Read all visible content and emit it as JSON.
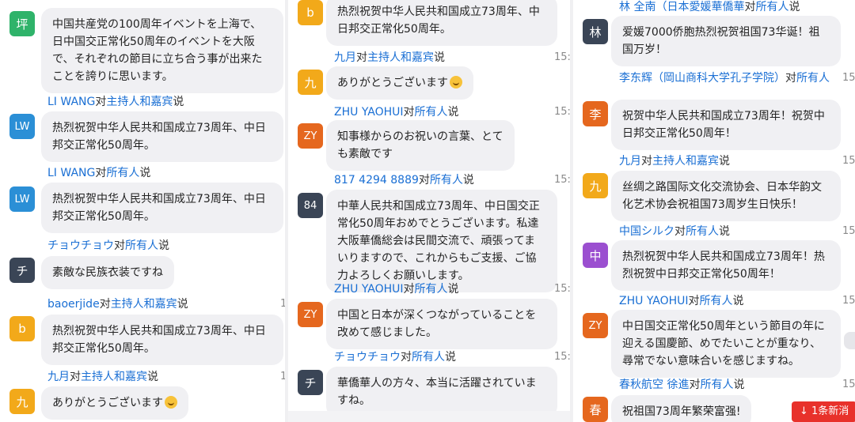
{
  "colors": {
    "link_blue": "#1a6fd4",
    "bubble_bg": "#f0f0f3",
    "new_msg_red": "#e8312b"
  },
  "col1": {
    "m1": {
      "avatar": "坪",
      "avatar_color": "#2fb36a",
      "text": "中国共産党の100周年イベントを上海で、日中国交正常化50周年のイベントを大阪で、それぞれの節目に立ち合う事が出来たことを誇りに思います。"
    },
    "m2": {
      "sender": "LI WANG",
      "to": "对",
      "target": "主持人和嘉宾",
      "verb": "说",
      "avatar": "LW",
      "avatar_color": "#2b8fd6",
      "text": "热烈祝贺中华人民共和国成立73周年、中日邦交正常化50周年。"
    },
    "m3": {
      "sender": "LI WANG",
      "to": "对",
      "target": "所有人",
      "verb": "说",
      "avatar": "LW",
      "avatar_color": "#2b8fd6",
      "text": "热烈祝贺中华人民共和国成立73周年、中日邦交正常化50周年。"
    },
    "m4": {
      "sender": "チョウチョウ",
      "to": "对",
      "target": "所有人",
      "verb": "说",
      "avatar": "チ",
      "avatar_color": "#3a4556",
      "text": "素敵な民族衣装ですね"
    },
    "m5": {
      "sender": "baoerjide",
      "to": "对",
      "target": "主持人和嘉宾",
      "verb": "说",
      "time": "1",
      "avatar": "b",
      "avatar_color": "#f2a91a",
      "text": "热烈祝贺中华人民共和国成立73周年、中日邦交正常化50周年。"
    },
    "m6": {
      "sender": "九月",
      "to": "对",
      "target": "主持人和嘉宾",
      "verb": "说",
      "time": "1",
      "avatar": "九",
      "avatar_color": "#f2a91a",
      "text": "ありがとうございます"
    }
  },
  "col2": {
    "m1": {
      "avatar": "b",
      "avatar_color": "#f2a91a",
      "text": "热烈祝贺中华人民共和国成立73周年、中日邦交正常化50周年。"
    },
    "m2": {
      "sender": "九月",
      "to": "对",
      "target": "主持人和嘉宾",
      "verb": "说",
      "time": "15:",
      "avatar": "九",
      "avatar_color": "#f2a91a",
      "text": "ありがとうございます"
    },
    "m3": {
      "sender": "ZHU YAOHUI",
      "to": "对",
      "target": "所有人",
      "verb": "说",
      "time": "15:",
      "avatar": "ZY",
      "avatar_color": "#e5671e",
      "text": "知事様からのお祝いの言葉、とても素敵です"
    },
    "m4": {
      "sender": "817 4294 8889",
      "to": "对",
      "target": "所有人",
      "verb": "说",
      "time": "15:",
      "avatar": "84",
      "avatar_color": "#3a4556",
      "text": "中華人民共和国成立73周年、中日国交正常化50周年おめでとうございます。私達大阪華僑総会は民間交流で、頑張ってまいりますので、これからもご支援、ご協力よろしくお願いします。"
    },
    "m5": {
      "sender": "ZHU YAOHUI",
      "to": "对",
      "target": "所有人",
      "verb": "说",
      "time": "15:",
      "avatar": "ZY",
      "avatar_color": "#e5671e",
      "text": "中国と日本が深くつながっていることを改めて感じました。"
    },
    "m6": {
      "sender": "チョウチョウ",
      "to": "对",
      "target": "所有人",
      "verb": "说",
      "time": "15:",
      "avatar": "チ",
      "avatar_color": "#3a4556",
      "text": "華僑華人の方々、本当に活躍されていますね。"
    }
  },
  "col3": {
    "m1": {
      "sender": "林 全南（日本愛媛華僑華",
      "to": "对",
      "target": "所有人",
      "verb": "说",
      "avatar": "林",
      "avatar_color": "#3a4556",
      "text": "爱媛7000侨胞热烈祝贺祖国73华诞！祖国万岁！"
    },
    "m2": {
      "sender": "李东辉（岡山商科大学孔子学院）",
      "to": "对",
      "target": "所有人",
      "verb": "",
      "time": "15",
      "avatar": "李",
      "avatar_color": "#e5671e",
      "text": "祝贺中华人民共和国成立73周年！祝贺中日邦交正常化50周年！"
    },
    "m3": {
      "sender": "九月",
      "to": "对",
      "target": "主持人和嘉宾",
      "verb": "说",
      "time": "15",
      "avatar": "九",
      "avatar_color": "#f2a91a",
      "text": "丝绸之路国际文化交流协会、日本华韵文化艺术协会祝祖国73周岁生日快乐！"
    },
    "m4": {
      "sender": "中国シルク",
      "to": "对",
      "target": "所有人",
      "verb": "说",
      "time": "15",
      "avatar": "中",
      "avatar_color": "#9b4fd0",
      "text": "热烈祝贺中华人民共和国成立73周年！热烈祝贺中日邦交正常化50周年！"
    },
    "m5": {
      "sender": "ZHU YAOHUI",
      "to": "对",
      "target": "所有人",
      "verb": "说",
      "time": "15",
      "avatar": "ZY",
      "avatar_color": "#e5671e",
      "text": "中日国交正常化50周年という節目の年に迎える国慶節、めでたいことが重なり、尋常でない意味合いを感じますね。"
    },
    "m6": {
      "sender": "春秋航空 徐進",
      "to": "对",
      "target": "所有人",
      "verb": "说",
      "time": "15",
      "avatar": "春",
      "avatar_color": "#e5671e",
      "text": "祝祖国73周年繁荣富强!"
    },
    "new_messages": "↓ 1条新消"
  }
}
